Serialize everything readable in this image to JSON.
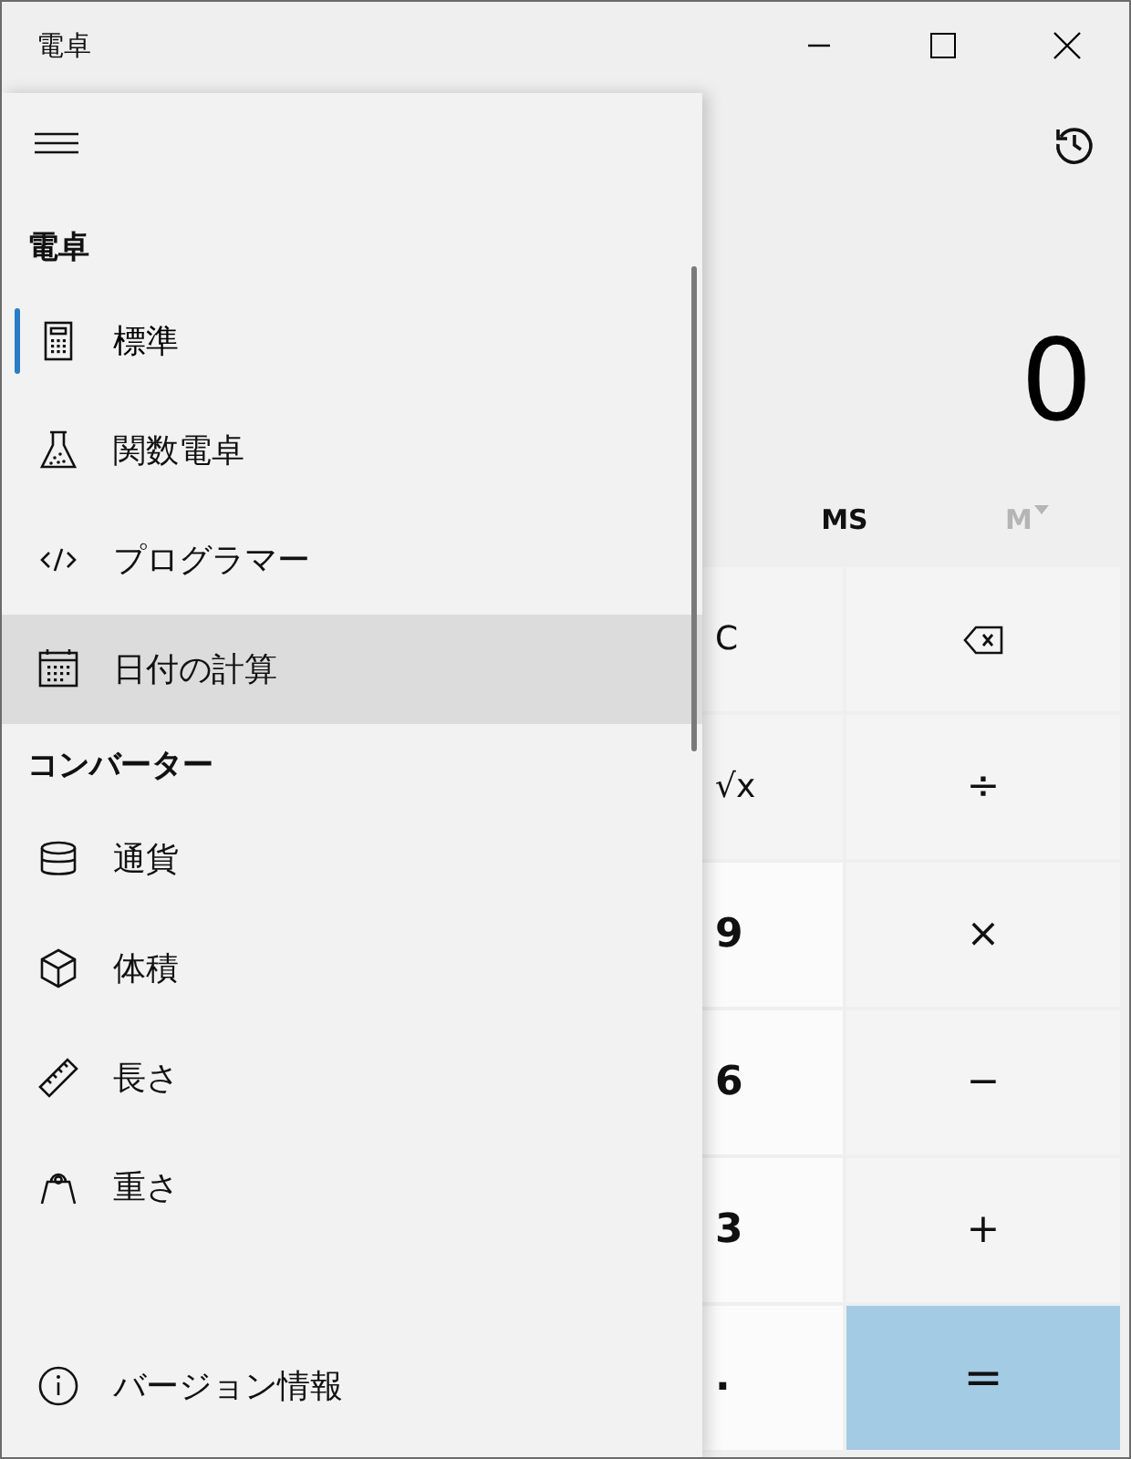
{
  "window": {
    "title": "電卓"
  },
  "display": {
    "value": "0"
  },
  "memory": [
    {
      "label": "MS",
      "disabled": false
    },
    {
      "label": "M",
      "disabled": true
    }
  ],
  "keys": [
    {
      "kind": "function",
      "label": "C"
    },
    {
      "kind": "backspace"
    },
    {
      "kind": "function",
      "label": "√x"
    },
    {
      "kind": "operator",
      "label": "÷"
    },
    {
      "kind": "digit",
      "label": "9"
    },
    {
      "kind": "operator",
      "label": "×"
    },
    {
      "kind": "digit",
      "label": "6"
    },
    {
      "kind": "operator",
      "label": "−"
    },
    {
      "kind": "digit",
      "label": "3"
    },
    {
      "kind": "operator",
      "label": "+"
    },
    {
      "kind": "digit",
      "label": "."
    },
    {
      "kind": "equals",
      "label": "="
    }
  ],
  "nav": {
    "sections": [
      {
        "title": "電卓",
        "items": [
          {
            "kind": "calculator",
            "label": "標準",
            "selected": true,
            "hovered": false
          },
          {
            "kind": "flask",
            "label": "関数電卓",
            "selected": false,
            "hovered": false
          },
          {
            "kind": "code",
            "label": "プログラマー",
            "selected": false,
            "hovered": false
          },
          {
            "kind": "calendar",
            "label": "日付の計算",
            "selected": false,
            "hovered": true
          }
        ]
      },
      {
        "title": "コンバーター",
        "items": [
          {
            "kind": "coins",
            "label": "通貨",
            "selected": false,
            "hovered": false
          },
          {
            "kind": "cube",
            "label": "体積",
            "selected": false,
            "hovered": false
          },
          {
            "kind": "ruler",
            "label": "長さ",
            "selected": false,
            "hovered": false
          },
          {
            "kind": "weight",
            "label": "重さ",
            "selected": false,
            "hovered": false
          }
        ]
      }
    ],
    "footer": {
      "kind": "info",
      "label": "バージョン情報"
    }
  }
}
